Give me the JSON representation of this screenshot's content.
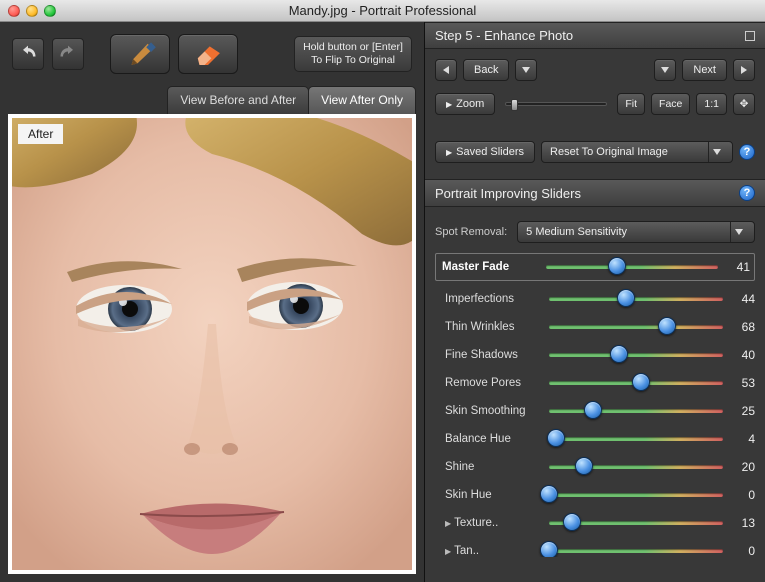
{
  "window": {
    "title": "Mandy.jpg - Portrait Professional"
  },
  "toolbar": {
    "hold_button": "Hold button or [Enter]\nTo Flip To Original"
  },
  "view_tabs": {
    "before_after": "View Before and After",
    "after_only": "View After Only",
    "active": "after_only"
  },
  "preview": {
    "label": "After"
  },
  "step": {
    "title": "Step 5 - Enhance Photo"
  },
  "nav": {
    "back": "Back",
    "next": "Next"
  },
  "zoom": {
    "label": "Zoom",
    "fit": "Fit",
    "face": "Face",
    "oneone": "1:1"
  },
  "saved": {
    "label": "Saved Sliders",
    "reset": "Reset To Original Image"
  },
  "improving": {
    "title": "Portrait Improving Sliders"
  },
  "spot": {
    "label": "Spot Removal:",
    "value": "5 Medium Sensitivity"
  },
  "sliders": [
    {
      "label": "Master Fade",
      "value": 41,
      "master": true
    },
    {
      "label": "Imperfections",
      "value": 44
    },
    {
      "label": "Thin Wrinkles",
      "value": 68
    },
    {
      "label": "Fine Shadows",
      "value": 40
    },
    {
      "label": "Remove Pores",
      "value": 53
    },
    {
      "label": "Skin Smoothing",
      "value": 25
    },
    {
      "label": "Balance Hue",
      "value": 4
    },
    {
      "label": "Shine",
      "value": 20
    },
    {
      "label": "Skin Hue",
      "value": 0
    },
    {
      "label": "Texture..",
      "value": 13,
      "sub": true
    },
    {
      "label": "Tan..",
      "value": 0,
      "sub": true
    }
  ]
}
